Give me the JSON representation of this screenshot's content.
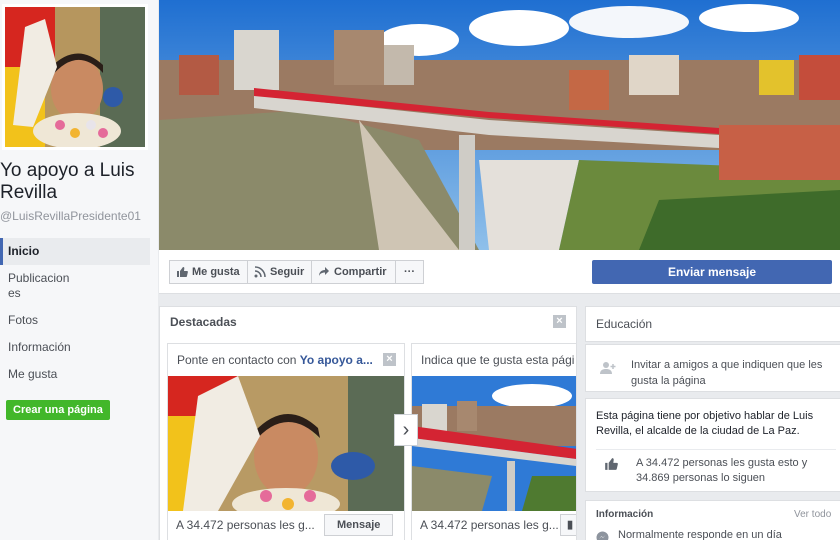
{
  "page": {
    "name": "Yo apoyo a Luis Revilla",
    "handle": "@LuisRevillaPresidente01"
  },
  "nav": [
    {
      "label": "Inicio"
    },
    {
      "label": "Publicaciones"
    },
    {
      "label": "Fotos"
    },
    {
      "label": "Información"
    },
    {
      "label": "Me gusta"
    }
  ],
  "create_page_label": "Crear una página",
  "actions": {
    "like": "Me gusta",
    "follow": "Seguir",
    "share": "Compartir",
    "more": "···",
    "send_message": "Enviar mensaje"
  },
  "featured": {
    "title": "Destacadas",
    "cards": [
      {
        "head_prefix": "Ponte en contacto con",
        "head_link": "Yo apoyo a...",
        "foot": "A 34.472 personas les g...",
        "button": "Mensaje"
      },
      {
        "head_prefix": "Indica que te gusta esta pági",
        "head_link": "",
        "foot": "A 34.472 personas les g...",
        "button": ""
      }
    ]
  },
  "right": {
    "education_title": "Educación",
    "invite_text": "Invitar a amigos a que indiquen que les gusta la página",
    "about_text": "Esta página tiene por objetivo hablar de Luis Revilla, el alcalde de la ciudad de La Paz.",
    "likes_text": "A 34.472 personas les gusta esto y 34.869 personas lo siguen",
    "info_title": "Información",
    "info_link": "Ver todo",
    "response_text": "Normalmente responde en un día"
  }
}
